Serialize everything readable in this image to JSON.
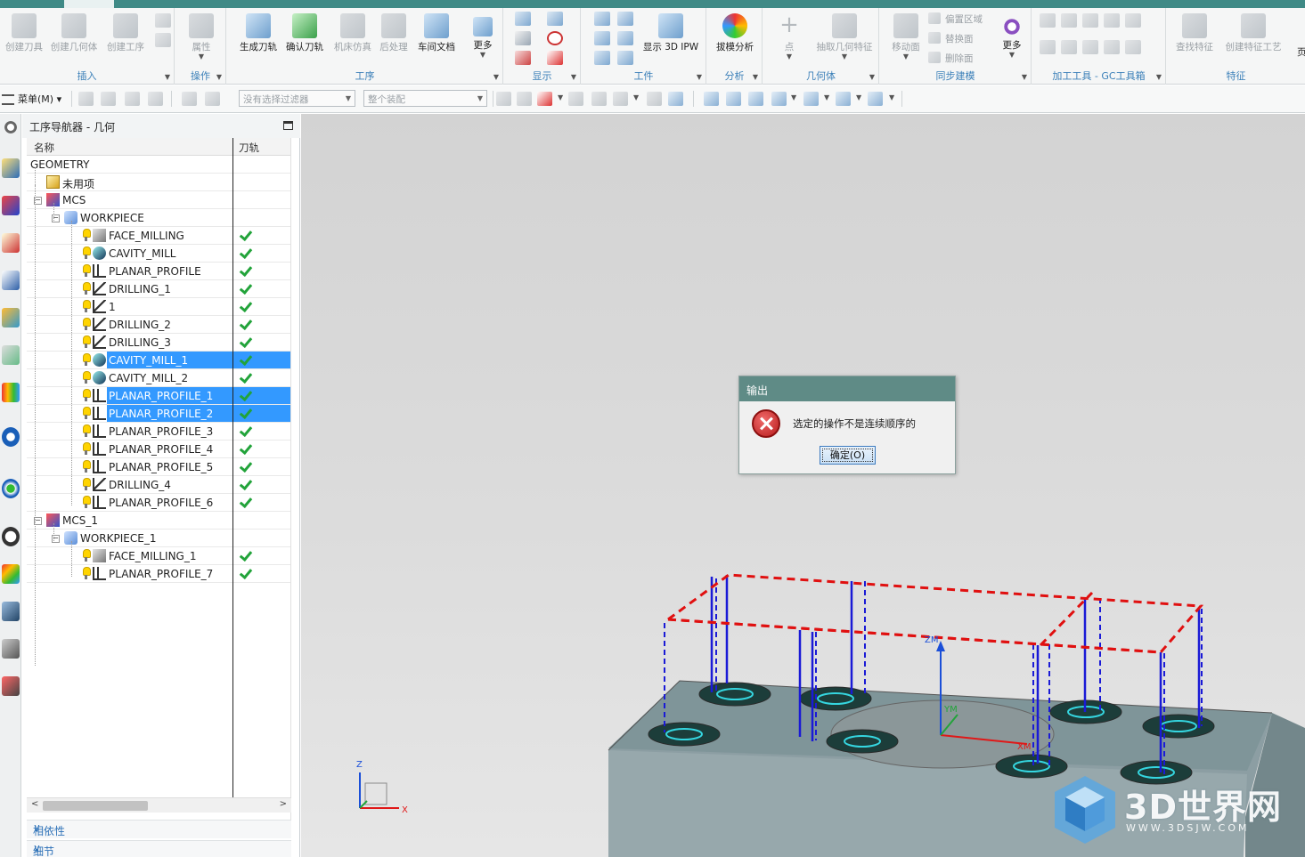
{
  "ribbon": {
    "groups": {
      "insert": "插入",
      "operation": "操作",
      "process": "工序",
      "display": "显示",
      "workpiece": "工件",
      "analysis": "分析",
      "geometry": "几何体",
      "sync_modeling": "同步建模",
      "gc_toolbox": "加工工具 - GC工具箱",
      "feature": "特征"
    },
    "buttons": {
      "create_tool": "创建刀具",
      "create_geometry": "创建几何体",
      "create_process": "创建工序",
      "properties": "属性",
      "generate_toolpath": "生成刀轨",
      "verify_toolpath": "确认刀轨",
      "machine_sim": "机床仿真",
      "postprocess": "后处理",
      "shop_doc": "车间文档",
      "more_process": "更多",
      "show_3d_ipw": "显示 3D IPW",
      "draft_analysis": "拔模分析",
      "point": "点",
      "extract_geometry": "抽取几何特征",
      "move_face": "移动面",
      "offset_region": "偏置区域",
      "replace_face": "替换面",
      "delete_face": "删除面",
      "more_sync": "更多",
      "find_feature": "查找特征",
      "create_feature_process": "创建特征工艺",
      "cut_edge": "页"
    }
  },
  "toolbar": {
    "menu": "菜单(M)",
    "filter_placeholder": "没有选择过滤器",
    "assembly_scope": "整个装配"
  },
  "navigator": {
    "title": "工序导航器 - 几何",
    "col_name": "名称",
    "col_toolpath": "刀轨",
    "rows": [
      {
        "name": "GEOMETRY"
      },
      {
        "name": "未用项"
      },
      {
        "name": "MCS"
      },
      {
        "name": "WORKPIECE"
      },
      {
        "name": "FACE_MILLING"
      },
      {
        "name": "CAVITY_MILL"
      },
      {
        "name": "PLANAR_PROFILE"
      },
      {
        "name": "DRILLING_1"
      },
      {
        "name": "1"
      },
      {
        "name": "DRILLING_2"
      },
      {
        "name": "DRILLING_3"
      },
      {
        "name": "CAVITY_MILL_1"
      },
      {
        "name": "CAVITY_MILL_2"
      },
      {
        "name": "PLANAR_PROFILE_1"
      },
      {
        "name": "PLANAR_PROFILE_2"
      },
      {
        "name": "PLANAR_PROFILE_3"
      },
      {
        "name": "PLANAR_PROFILE_4"
      },
      {
        "name": "PLANAR_PROFILE_5"
      },
      {
        "name": "DRILLING_4"
      },
      {
        "name": "PLANAR_PROFILE_6"
      },
      {
        "name": "MCS_1"
      },
      {
        "name": "WORKPIECE_1"
      },
      {
        "name": "FACE_MILLING_1"
      },
      {
        "name": "PLANAR_PROFILE_7"
      }
    ],
    "dependencies": "相依性",
    "details": "细节"
  },
  "dialog": {
    "title": "输出",
    "message": "选定的操作不是连续顺序的",
    "ok": "确定(O)"
  },
  "viewport": {
    "axis_z": "Z",
    "axis_x": "X",
    "wcs_zm": "ZM",
    "wcs_ym": "YM",
    "wcs_xm": "XM"
  },
  "watermark": {
    "brand": "3D世界网",
    "url": "WWW.3DSJW.COM"
  },
  "colors": {
    "title_teal": "#5f8b86",
    "selection": "#3399ff",
    "check_green": "#22a33a",
    "toolpath_blue": "#1a1ad6",
    "boundary_red": "#e01010"
  }
}
